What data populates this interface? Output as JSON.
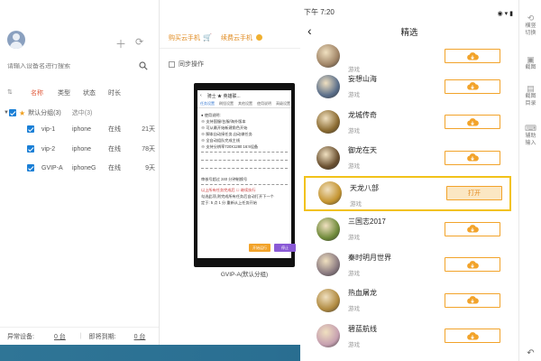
{
  "left_panel": {
    "search_placeholder": "请输入设备名进行搜索",
    "columns": {
      "name": "名称",
      "type": "类型",
      "status": "状态",
      "time": "时长"
    },
    "group": {
      "name": "默认分组(3)",
      "selected": "选中(3)"
    },
    "devices": [
      {
        "name": "vip-1",
        "type": "iphone",
        "status": "在线",
        "days": "21天"
      },
      {
        "name": "vip-2",
        "type": "iphone",
        "status": "在线",
        "days": "78天"
      },
      {
        "name": "GVIP-A",
        "type": "iphoneG",
        "status": "在线",
        "days": "9天"
      }
    ],
    "footer": {
      "abnormal_label": "异常设备:",
      "abnormal_value": "0 台",
      "expiring_label": "即将到期:",
      "expiring_value": "0 台"
    }
  },
  "middle_panel": {
    "tabs": [
      "购买云手机",
      "续费云手机"
    ],
    "sync_label": "同步操作",
    "phone_screen": {
      "title": "骑士 ★ 英雄联...",
      "tabs": [
        "任务设置",
        "刷怪设置",
        "其他设置",
        "使用说明",
        "高级设置"
      ],
      "lines": [
        "● 使用说明:",
        "※ 支持国服/台服/海外版本",
        "※ 可从最开始新建角色开始",
        "※ 脚本自动接任务,自动做任务",
        "※ 全自动组队完成主线",
        "※ 支持分辨率720X1280 16:9设备"
      ],
      "check_line_1": "审核号超过 240 分钟制换号",
      "check_line_2": "以上所有任务完成后 ☐ 继续执行",
      "check_line_3": "勾选此项,则完成所有任务后自动打开下一个",
      "check_line_4": "定于: 5 点 1 分 重新从上任务开始",
      "buttons": [
        "开始运行",
        "停止"
      ]
    },
    "caption": "GVIP-A(默认分组)"
  },
  "right_panel": {
    "time": "下午 7:20",
    "title": "精选",
    "games": [
      {
        "name": "",
        "sub": "游戏",
        "btn": "download",
        "color": "#a08466"
      },
      {
        "name": "妄想山海",
        "sub": "游戏",
        "btn": "download",
        "color": "#5a6e8a"
      },
      {
        "name": "龙城传奇",
        "sub": "游戏",
        "btn": "download",
        "color": "#8a6a30"
      },
      {
        "name": "御龙在天",
        "sub": "游戏",
        "btn": "download",
        "color": "#6a5030"
      },
      {
        "name": "天龙八部",
        "sub": "游戏",
        "btn": "open",
        "open_label": "打开",
        "color": "#c49430"
      },
      {
        "name": "三国志2017",
        "sub": "游戏",
        "btn": "download",
        "color": "#6f8a3a"
      },
      {
        "name": "秦时明月世界",
        "sub": "游戏",
        "btn": "download",
        "color": "#8a7a80"
      },
      {
        "name": "热血屠龙",
        "sub": "游戏",
        "btn": "download",
        "color": "#b08a40"
      },
      {
        "name": "碧蓝航线",
        "sub": "游戏",
        "btn": "download",
        "color": "#c6a0b0"
      }
    ]
  },
  "side_toolbar": {
    "items": [
      {
        "label": "横竖\n切换",
        "glyph": "⟲"
      },
      {
        "label": "截图",
        "glyph": "▣"
      },
      {
        "label": "截图\n目录",
        "glyph": "▤"
      },
      {
        "label": "辅助\n输入",
        "glyph": "⌨"
      }
    ]
  },
  "colors": {
    "accent": "#f2a32a",
    "checkbox": "#1a7fd6",
    "highlight": "#f2c21a"
  }
}
